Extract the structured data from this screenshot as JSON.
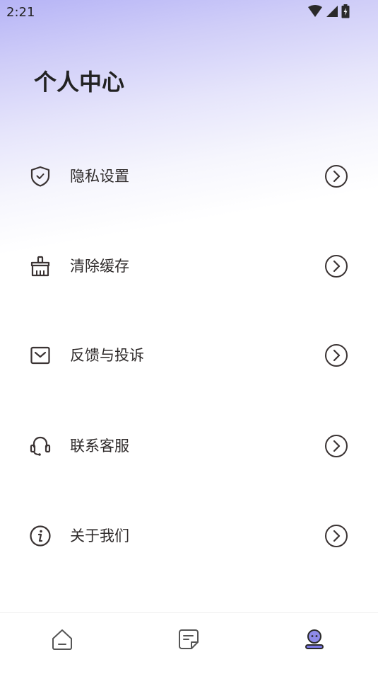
{
  "status_bar": {
    "time": "2:21"
  },
  "page": {
    "title": "个人中心"
  },
  "menu": [
    {
      "label": "隐私设置",
      "icon": "shield-icon"
    },
    {
      "label": "清除缓存",
      "icon": "brush-icon"
    },
    {
      "label": "反馈与投诉",
      "icon": "mailbox-icon"
    },
    {
      "label": "联系客服",
      "icon": "headset-icon"
    },
    {
      "label": "关于我们",
      "icon": "info-icon"
    }
  ],
  "bottom_nav": {
    "tabs": [
      {
        "icon": "home-icon",
        "active": false
      },
      {
        "icon": "note-icon",
        "active": false
      },
      {
        "icon": "profile-icon",
        "active": true
      }
    ],
    "active_color": "#7b78e6",
    "inactive_color": "#555555"
  },
  "colors": {
    "gradient_top": "#b6b4f6",
    "text": "#2e2a2a"
  }
}
